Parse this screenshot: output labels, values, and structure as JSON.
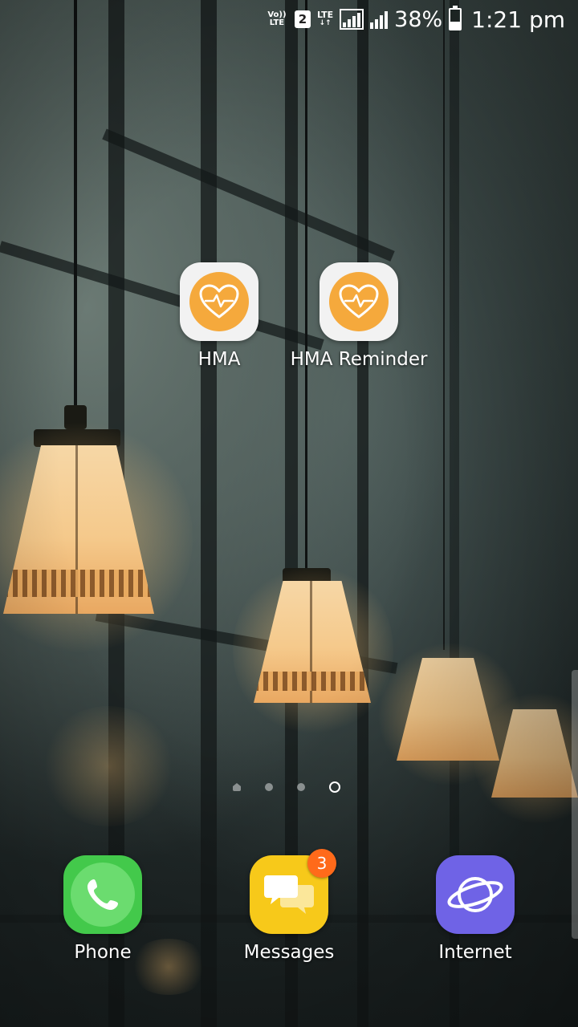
{
  "status_bar": {
    "volte": "Vo)) LTE",
    "sim_slot": "2",
    "network": "LTE",
    "battery_percent": "38%",
    "battery_level": 0.38,
    "time": "1:21 pm"
  },
  "home_apps": [
    {
      "label": "HMA",
      "icon": "heart-pulse-icon",
      "color": "#f5a93c"
    },
    {
      "label": "HMA Reminder",
      "icon": "heart-pulse-icon",
      "color": "#f5a93c"
    }
  ],
  "page_indicator": {
    "pages": 4,
    "active_index": 3
  },
  "dock": [
    {
      "label": "Phone",
      "icon": "phone-icon",
      "color": "#43c94b"
    },
    {
      "label": "Messages",
      "icon": "messages-icon",
      "color": "#f7c91a",
      "badge": "3"
    },
    {
      "label": "Internet",
      "icon": "planet-icon",
      "color": "#6f63e6"
    }
  ]
}
